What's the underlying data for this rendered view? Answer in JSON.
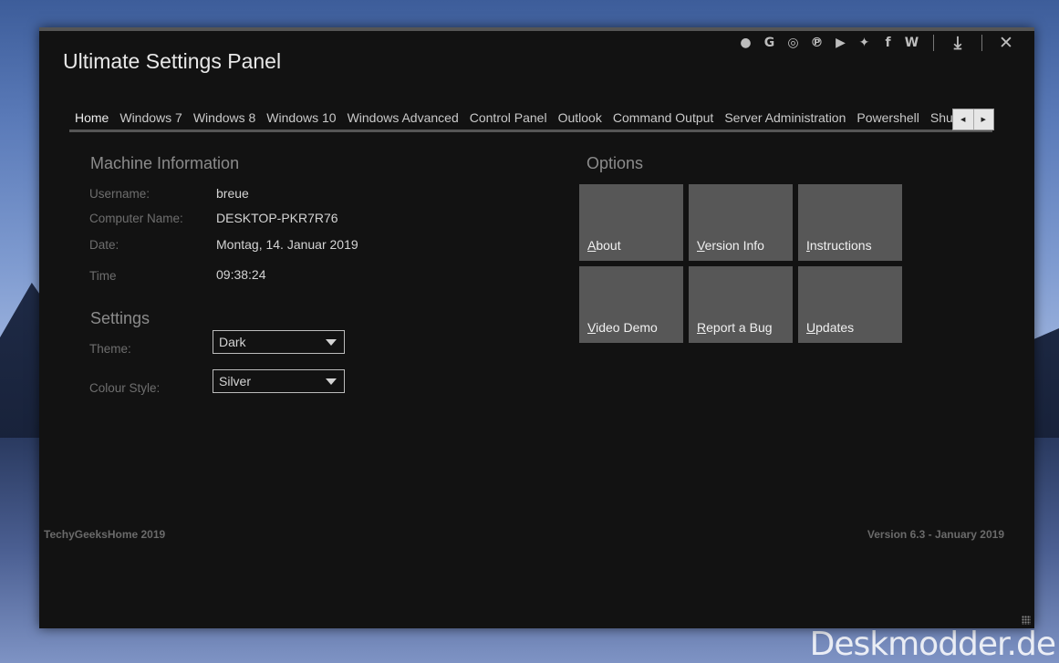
{
  "app": {
    "title": "Ultimate Settings Panel"
  },
  "top_icons": [
    {
      "name": "github-icon",
      "glyph": "●"
    },
    {
      "name": "google-icon",
      "glyph": "G"
    },
    {
      "name": "instagram-icon",
      "glyph": "◎"
    },
    {
      "name": "pinterest-icon",
      "glyph": "℗"
    },
    {
      "name": "youtube-icon",
      "glyph": "▶"
    },
    {
      "name": "twitter-icon",
      "glyph": "✦"
    },
    {
      "name": "facebook-icon",
      "glyph": "f"
    },
    {
      "name": "wordpress-icon",
      "glyph": "W"
    }
  ],
  "window_controls": {
    "download_glyph": "⤓",
    "close_glyph": "✕"
  },
  "tabs": [
    {
      "label": "Home"
    },
    {
      "label": "Windows 7"
    },
    {
      "label": "Windows 8"
    },
    {
      "label": "Windows 10"
    },
    {
      "label": "Windows Advanced"
    },
    {
      "label": "Control Panel"
    },
    {
      "label": "Outlook"
    },
    {
      "label": "Command Output"
    },
    {
      "label": "Server Administration"
    },
    {
      "label": "Powershell"
    },
    {
      "label": "Shutdown C"
    }
  ],
  "tab_scroll": {
    "left": "◀",
    "right": "▶"
  },
  "machine_info": {
    "heading": "Machine Information",
    "username_label": "Username:",
    "username": "breue",
    "computer_label": "Computer Name:",
    "computer": "DESKTOP-PKR7R76",
    "date_label": "Date:",
    "date": "Montag, 14. Januar 2019",
    "time_label": "Time",
    "time": "09:38:24"
  },
  "settings": {
    "heading": "Settings",
    "theme_label": "Theme:",
    "theme_value": "Dark",
    "colour_label": "Colour Style:",
    "colour_value": "Silver"
  },
  "options": {
    "heading": "Options",
    "tiles": [
      {
        "label": "About"
      },
      {
        "label": "Version Info"
      },
      {
        "label": "Instructions"
      },
      {
        "label": "Video Demo"
      },
      {
        "label": "Report a Bug"
      },
      {
        "label": "Updates"
      }
    ]
  },
  "footer": {
    "left": "TechyGeeksHome 2019",
    "right": "Version 6.3 - January 2019"
  },
  "watermark": "Deskmodder.de"
}
